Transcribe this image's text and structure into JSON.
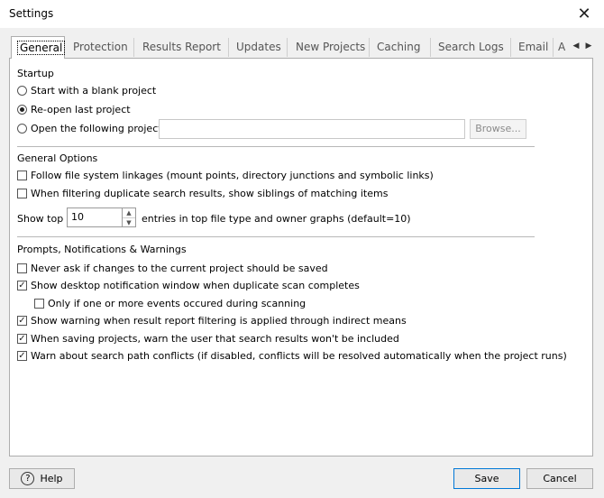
{
  "window": {
    "title": "Settings",
    "close": "✕"
  },
  "tabs": [
    {
      "label": "General"
    },
    {
      "label": "Protection"
    },
    {
      "label": "Results Report"
    },
    {
      "label": "Updates"
    },
    {
      "label": "New Projects"
    },
    {
      "label": "Caching"
    },
    {
      "label": "Search Logs"
    },
    {
      "label": "Email"
    },
    {
      "label": "A"
    }
  ],
  "startup": {
    "heading": "Startup",
    "opt_blank": "Start with a blank project",
    "opt_reopen": "Re-open last project",
    "opt_open_following": "Open the following project:",
    "project_path": "",
    "browse": "Browse..."
  },
  "general": {
    "heading": "General Options",
    "follow_links": "Follow file system linkages (mount points, directory junctions and symbolic links)",
    "show_siblings": "When filtering duplicate search results, show siblings of matching items",
    "show_top_prefix": "Show top",
    "show_top_value": "10",
    "show_top_suffix": "entries in top file type and owner graphs (default=10)"
  },
  "prompts": {
    "heading": "Prompts, Notifications & Warnings",
    "never_ask": "Never ask if changes to the current project should be saved",
    "show_desktop": "Show desktop notification window when duplicate scan completes",
    "only_if_events": "Only if one or more events occured during scanning",
    "show_warning_filter": "Show warning when result report filtering is applied through indirect means",
    "warn_saving": "When saving projects, warn the user that search results won't be included",
    "warn_conflicts": "Warn about search path conflicts (if disabled, conflicts will be resolved automatically when the project runs)"
  },
  "footer": {
    "help": "Help",
    "help_icon": "?",
    "save": "Save",
    "cancel": "Cancel"
  }
}
